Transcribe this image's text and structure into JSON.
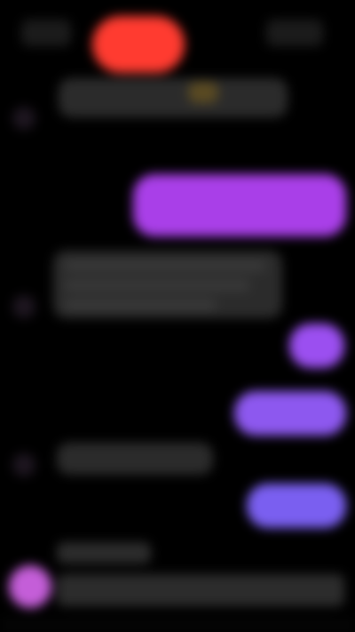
{
  "screen": {
    "background": "#000000",
    "blurred": true
  },
  "header": {
    "notification_badge_color": "#ff3b30"
  },
  "messages": [
    {
      "direction": "incoming",
      "lines": 1,
      "has_emoji": true
    },
    {
      "direction": "outgoing",
      "color": "#a93fe8"
    },
    {
      "direction": "incoming",
      "lines": 3
    },
    {
      "direction": "outgoing",
      "color": "#9b4ff0"
    },
    {
      "direction": "outgoing",
      "color": "#8d58ef"
    },
    {
      "direction": "incoming",
      "lines": 1
    },
    {
      "direction": "outgoing",
      "color": "#7a5ff0"
    },
    {
      "direction": "incoming",
      "lines": 2,
      "avatar_color": "#c45ed8"
    }
  ]
}
